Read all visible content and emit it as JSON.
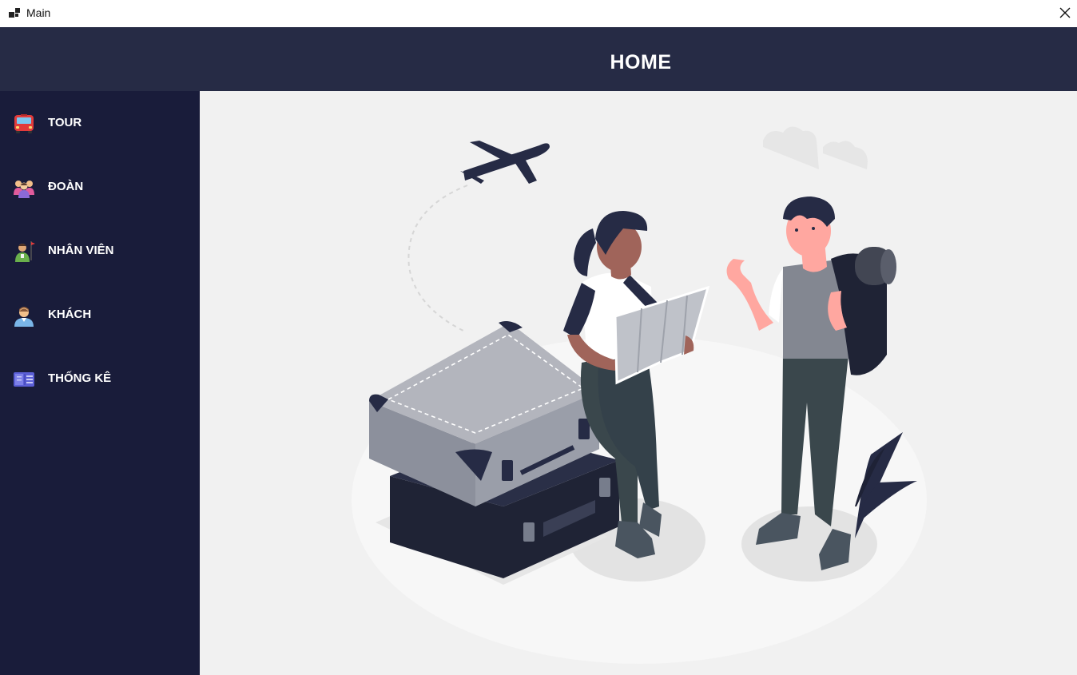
{
  "window": {
    "title": "Main",
    "icons": {
      "app": "window-app-icon",
      "close": "close-icon"
    }
  },
  "header": {
    "title": "HOME",
    "background": "#262b45"
  },
  "sidebar": {
    "background": "#191c3a",
    "items": [
      {
        "label": "TOUR",
        "icon": "bus-icon"
      },
      {
        "label": "ĐOÀN",
        "icon": "group-icon"
      },
      {
        "label": "NHÂN VIÊN",
        "icon": "guide-icon"
      },
      {
        "label": "KHÁCH",
        "icon": "customer-icon"
      },
      {
        "label": "THỐNG KÊ",
        "icon": "statistics-icon"
      }
    ]
  },
  "content": {
    "background": "#f1f1f1",
    "illustration": "travelers-illustration"
  }
}
